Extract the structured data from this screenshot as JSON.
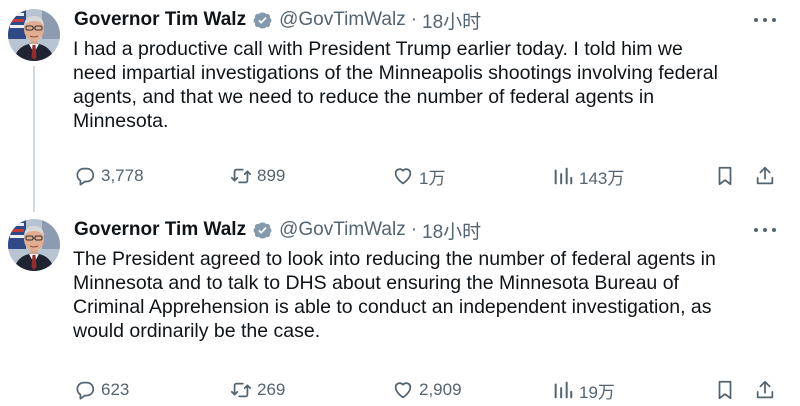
{
  "tweets": [
    {
      "author": {
        "name": "Governor Tim Walz",
        "handle": "@GovTimWalz",
        "separator": "·",
        "time": "18小时"
      },
      "text_lines": [
        "I had a productive call with President Trump earlier today. I told him we",
        "need impartial investigations of the Minneapolis shootings involving federal",
        "agents, and that we need to reduce the number of federal agents in",
        "Minnesota."
      ],
      "stats": {
        "replies": "3,778",
        "reposts": "899",
        "likes": "1万",
        "views": "143万"
      }
    },
    {
      "author": {
        "name": "Governor Tim Walz",
        "handle": "@GovTimWalz",
        "separator": "·",
        "time": "18小时"
      },
      "text_lines": [
        "The President agreed to look into reducing the number of federal agents in",
        "Minnesota and to talk to DHS about ensuring the Minnesota Bureau of",
        "Criminal Apprehension is able to conduct an independent investigation, as",
        "would ordinarily be the case."
      ],
      "stats": {
        "replies": "623",
        "reposts": "269",
        "likes": "2,909",
        "views": "19万"
      }
    }
  ],
  "icons": {
    "verified": "verified-badge-icon",
    "more": "more-horizontal-icon",
    "reply": "reply-bubble-icon",
    "repost": "repost-arrows-icon",
    "like": "heart-icon",
    "views": "views-bar-chart-icon",
    "bookmark": "bookmark-icon",
    "share": "share-upload-icon"
  },
  "colors": {
    "text": "#0f1419",
    "muted": "#536471",
    "verified_badge": "#829aab",
    "thread_line": "#cfd9de"
  }
}
